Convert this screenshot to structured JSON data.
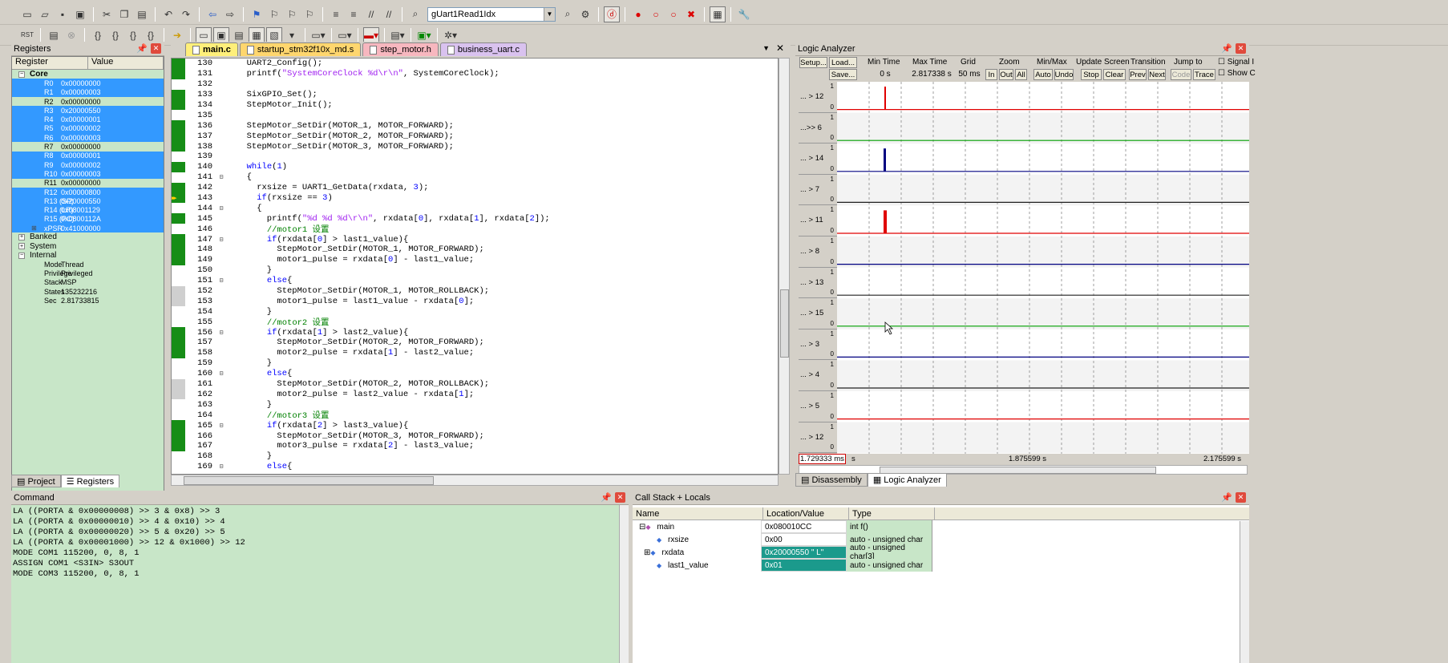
{
  "toolbar1": {
    "target_combo": "gUart1Read1Idx"
  },
  "registers": {
    "title": "Registers",
    "col_register": "Register",
    "col_value": "Value",
    "core_label": "Core",
    "rows": [
      {
        "name": "R0",
        "value": "0x00000000",
        "hl": true
      },
      {
        "name": "R1",
        "value": "0x00000003",
        "hl": true
      },
      {
        "name": "R2",
        "value": "0x00000000",
        "hl": false
      },
      {
        "name": "R3",
        "value": "0x20000550",
        "hl": true
      },
      {
        "name": "R4",
        "value": "0x00000001",
        "hl": true
      },
      {
        "name": "R5",
        "value": "0x00000002",
        "hl": true
      },
      {
        "name": "R6",
        "value": "0x00000003",
        "hl": true
      },
      {
        "name": "R7",
        "value": "0x00000000",
        "hl": false
      },
      {
        "name": "R8",
        "value": "0x00000001",
        "hl": true
      },
      {
        "name": "R9",
        "value": "0x00000002",
        "hl": true
      },
      {
        "name": "R10",
        "value": "0x00000003",
        "hl": true
      },
      {
        "name": "R11",
        "value": "0x00000000",
        "hl": false
      },
      {
        "name": "R12",
        "value": "0x00000800",
        "hl": true
      },
      {
        "name": "R13 (SP)",
        "value": "0x20000550",
        "hl": true
      },
      {
        "name": "R14 (LR)",
        "value": "0x08001129",
        "hl": true
      },
      {
        "name": "R15 (PC)",
        "value": "0x0800112A",
        "hl": true
      },
      {
        "name": "xPSR",
        "value": "0x41000000",
        "hl": true
      }
    ],
    "groups": [
      "Banked",
      "System",
      "Internal"
    ],
    "internal": [
      {
        "name": "Mode",
        "value": "Thread"
      },
      {
        "name": "Privilege",
        "value": "Privileged"
      },
      {
        "name": "Stack",
        "value": "MSP"
      },
      {
        "name": "States",
        "value": "135232216"
      },
      {
        "name": "Sec",
        "value": "2.81733815"
      }
    ],
    "tab_project": "Project",
    "tab_registers": "Registers"
  },
  "editor": {
    "tabs": [
      "main.c",
      "startup_stm32f10x_md.s",
      "step_motor.h",
      "business_uart.c"
    ],
    "lines": [
      {
        "n": "130",
        "t": "  UART2_Config();",
        "m": "g",
        "f": ""
      },
      {
        "n": "131",
        "t": "  printf(\"SystemCoreClock %d\\r\\n\", SystemCoreClock);",
        "m": "g",
        "f": ""
      },
      {
        "n": "132",
        "t": "",
        "m": "",
        "f": ""
      },
      {
        "n": "133",
        "t": "  SixGPIO_Set();",
        "m": "g",
        "f": ""
      },
      {
        "n": "134",
        "t": "  StepMotor_Init();",
        "m": "g",
        "f": ""
      },
      {
        "n": "135",
        "t": "",
        "m": "",
        "f": ""
      },
      {
        "n": "136",
        "t": "  StepMotor_SetDir(MOTOR_1, MOTOR_FORWARD);",
        "m": "g",
        "f": ""
      },
      {
        "n": "137",
        "t": "  StepMotor_SetDir(MOTOR_2, MOTOR_FORWARD);",
        "m": "g",
        "f": ""
      },
      {
        "n": "138",
        "t": "  StepMotor_SetDir(MOTOR_3, MOTOR_FORWARD);",
        "m": "g",
        "f": ""
      },
      {
        "n": "139",
        "t": "",
        "m": "",
        "f": ""
      },
      {
        "n": "140",
        "t": "  while(1)",
        "m": "g",
        "f": ""
      },
      {
        "n": "141",
        "t": "  {",
        "m": "",
        "f": "⊟"
      },
      {
        "n": "142",
        "t": "    rxsize = UART1_GetData(rxdata, 3);",
        "m": "g",
        "f": ""
      },
      {
        "n": "143",
        "t": "    if(rxsize == 3)",
        "m": "arrow",
        "f": ""
      },
      {
        "n": "144",
        "t": "    {",
        "m": "",
        "f": "⊟"
      },
      {
        "n": "145",
        "t": "      printf(\"%d %d %d\\r\\n\", rxdata[0], rxdata[1], rxdata[2]);",
        "m": "g",
        "f": ""
      },
      {
        "n": "146",
        "t": "      //motor1 设置",
        "m": "",
        "f": ""
      },
      {
        "n": "147",
        "t": "      if(rxdata[0] > last1_value){",
        "m": "g",
        "f": "⊟"
      },
      {
        "n": "148",
        "t": "        StepMotor_SetDir(MOTOR_1, MOTOR_FORWARD);",
        "m": "g",
        "f": ""
      },
      {
        "n": "149",
        "t": "        motor1_pulse = rxdata[0] - last1_value;",
        "m": "g",
        "f": ""
      },
      {
        "n": "150",
        "t": "      }",
        "m": "",
        "f": ""
      },
      {
        "n": "151",
        "t": "      else{",
        "m": "",
        "f": "⊟"
      },
      {
        "n": "152",
        "t": "        StepMotor_SetDir(MOTOR_1, MOTOR_ROLLBACK);",
        "m": "gray",
        "f": ""
      },
      {
        "n": "153",
        "t": "        motor1_pulse = last1_value - rxdata[0];",
        "m": "gray",
        "f": ""
      },
      {
        "n": "154",
        "t": "      }",
        "m": "",
        "f": ""
      },
      {
        "n": "155",
        "t": "      //motor2 设置",
        "m": "",
        "f": ""
      },
      {
        "n": "156",
        "t": "      if(rxdata[1] > last2_value){",
        "m": "g",
        "f": "⊟"
      },
      {
        "n": "157",
        "t": "        StepMotor_SetDir(MOTOR_2, MOTOR_FORWARD);",
        "m": "g",
        "f": ""
      },
      {
        "n": "158",
        "t": "        motor2_pulse = rxdata[1] - last2_value;",
        "m": "g",
        "f": ""
      },
      {
        "n": "159",
        "t": "      }",
        "m": "",
        "f": ""
      },
      {
        "n": "160",
        "t": "      else{",
        "m": "",
        "f": "⊟"
      },
      {
        "n": "161",
        "t": "        StepMotor_SetDir(MOTOR_2, MOTOR_ROLLBACK);",
        "m": "gray",
        "f": ""
      },
      {
        "n": "162",
        "t": "        motor2_pulse = last2_value - rxdata[1];",
        "m": "gray",
        "f": ""
      },
      {
        "n": "163",
        "t": "      }",
        "m": "",
        "f": ""
      },
      {
        "n": "164",
        "t": "      //motor3 设置",
        "m": "",
        "f": ""
      },
      {
        "n": "165",
        "t": "      if(rxdata[2] > last3_value){",
        "m": "g",
        "f": "⊟"
      },
      {
        "n": "166",
        "t": "        StepMotor_SetDir(MOTOR_3, MOTOR_FORWARD);",
        "m": "g",
        "f": ""
      },
      {
        "n": "167",
        "t": "        motor3_pulse = rxdata[2] - last3_value;",
        "m": "g",
        "f": ""
      },
      {
        "n": "168",
        "t": "      }",
        "m": "",
        "f": ""
      },
      {
        "n": "169",
        "t": "      else{",
        "m": "",
        "f": "⊟"
      }
    ]
  },
  "logic_analyzer": {
    "title": "Logic Analyzer",
    "setup": "Setup...",
    "load": "Load...",
    "save": "Save...",
    "min_time_label": "Min Time",
    "min_time": "0 s",
    "max_time_label": "Max Time",
    "max_time": "2.817338 s",
    "grid_label": "Grid",
    "grid": "50 ms",
    "zoom_label": "Zoom",
    "zoom_in": "In",
    "zoom_out": "Out",
    "zoom_all": "All",
    "minmax_label": "Min/Max",
    "auto": "Auto",
    "undo": "Undo",
    "update_label": "Update Screen",
    "stop": "Stop",
    "clear": "Clear",
    "transition_label": "Transition",
    "prev": "Prev",
    "next": "Next",
    "jump_label": "Jump to",
    "code": "Code",
    "trace": "Trace",
    "signal_info": "Signal I",
    "show_cycles": "Show C",
    "signals": [
      "... > 12",
      "...>> 6",
      "... > 14",
      "... > 7",
      "... > 11",
      "... > 8",
      "... > 13",
      "... > 15",
      "... > 3",
      "... > 4",
      "... > 5",
      "... > 12"
    ],
    "time_left": "1.729333 ms",
    "time_left_unit": "s",
    "time_mid": "1.875599 s",
    "time_right": "2.175599 s",
    "tab_disassembly": "Disassembly",
    "tab_la": "Logic Analyzer",
    "colors": {
      "red": "#e00000",
      "green": "#00a000",
      "blue": "#000080",
      "dark": "#202020"
    }
  },
  "command": {
    "title": "Command",
    "lines": [
      "LA ((PORTA & 0x00000008) >> 3 & 0x8) >> 3",
      "LA ((PORTA & 0x00000010) >> 4 & 0x10) >> 4",
      "LA ((PORTA & 0x00000020) >> 5 & 0x20) >> 5",
      "LA ((PORTA & 0x00001000) >> 12 & 0x1000) >> 12",
      "MODE COM1 115200, 0, 8, 1",
      "ASSIGN COM1 <S3IN> S3OUT",
      "MODE COM3 115200, 0, 8, 1"
    ]
  },
  "callstack": {
    "title": "Call Stack + Locals",
    "col_name": "Name",
    "col_loc": "Location/Value",
    "col_type": "Type",
    "rows": [
      {
        "name": "main",
        "value": "0x080010CC",
        "type": "int f()",
        "hl": false
      },
      {
        "name": "rxsize",
        "value": "0x00",
        "type": "auto - unsigned char",
        "hl": false
      },
      {
        "name": "rxdata",
        "value": "0x20000550 \"      L\"",
        "type": "auto - unsigned char[3]",
        "hl": true
      },
      {
        "name": "last1_value",
        "value": "0x01",
        "type": "auto - unsigned char",
        "hl": true
      }
    ]
  }
}
